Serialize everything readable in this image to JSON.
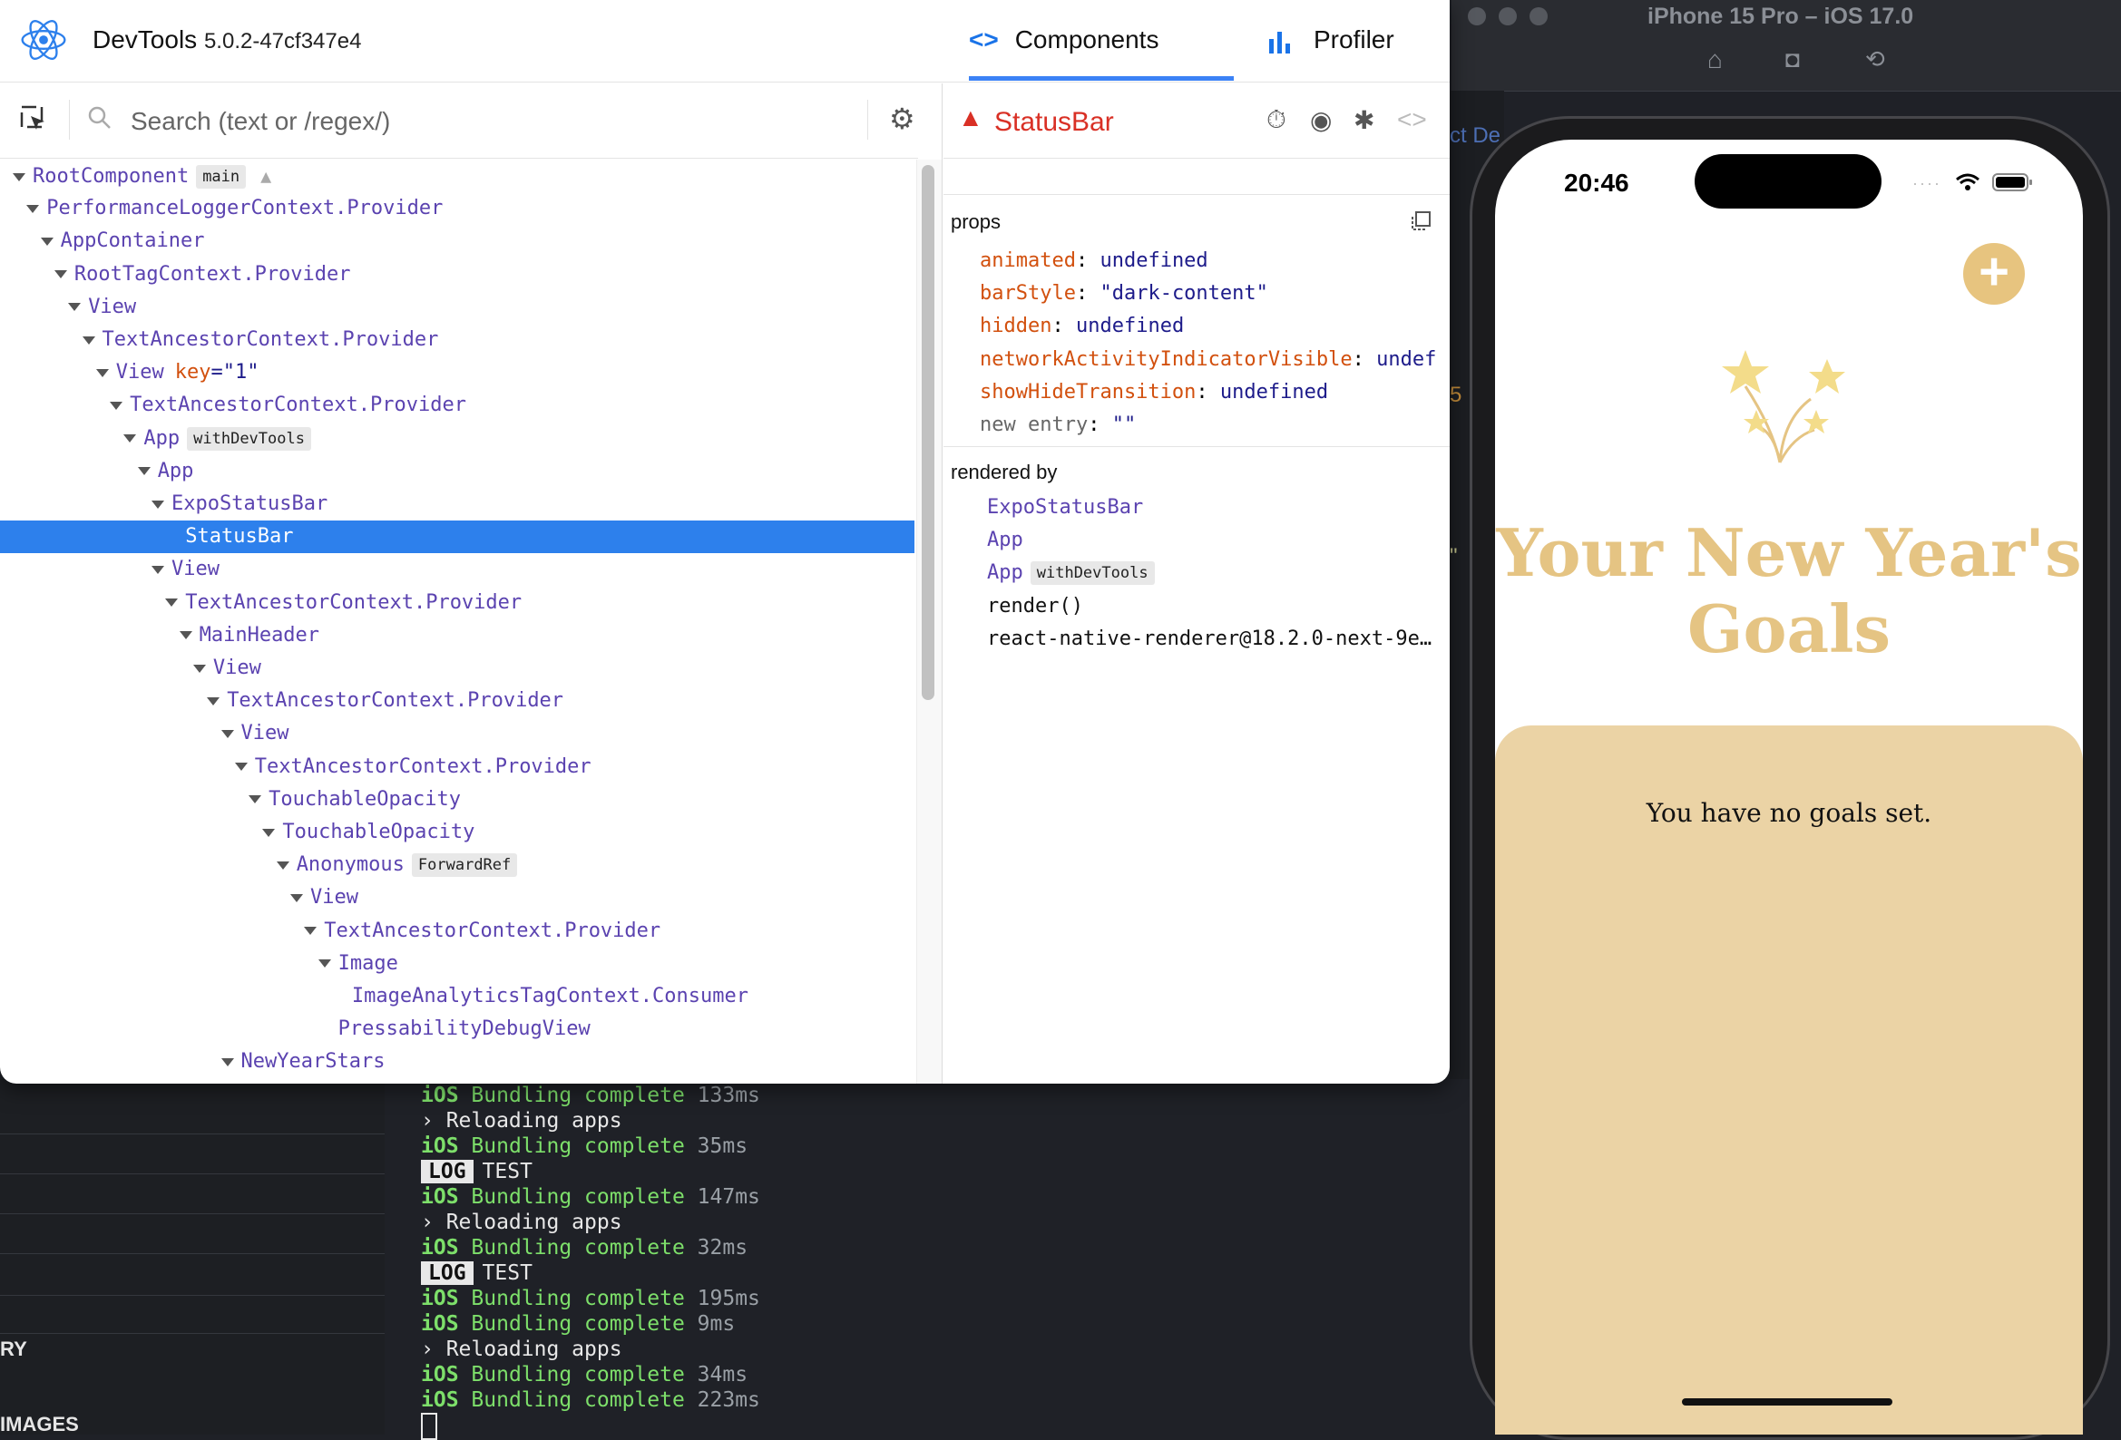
{
  "devtools": {
    "app_name": "DevTools",
    "version": "5.0.2-47cf347e4",
    "tabs": [
      {
        "label": "Components",
        "icon": "code-brackets-icon",
        "active": true
      },
      {
        "label": "Profiler",
        "icon": "bar-chart-icon",
        "active": false
      }
    ],
    "search_placeholder": "Search (text or /regex/)",
    "tree": [
      {
        "name": "RootComponent",
        "badge": "main",
        "warning": true
      },
      {
        "name": "PerformanceLoggerContext.Provider"
      },
      {
        "name": "AppContainer"
      },
      {
        "name": "RootTagContext.Provider"
      },
      {
        "name": "View"
      },
      {
        "name": "TextAncestorContext.Provider"
      },
      {
        "name": "View",
        "key_label": "key",
        "key_eq": "=",
        "key_value": "\"1\""
      },
      {
        "name": "TextAncestorContext.Provider"
      },
      {
        "name": "App",
        "badge": "withDevTools"
      },
      {
        "name": "App"
      },
      {
        "name": "ExpoStatusBar"
      },
      {
        "name": "StatusBar",
        "selected": true
      },
      {
        "name": "View"
      },
      {
        "name": "TextAncestorContext.Provider"
      },
      {
        "name": "MainHeader"
      },
      {
        "name": "View"
      },
      {
        "name": "TextAncestorContext.Provider"
      },
      {
        "name": "View"
      },
      {
        "name": "TextAncestorContext.Provider"
      },
      {
        "name": "TouchableOpacity"
      },
      {
        "name": "TouchableOpacity"
      },
      {
        "name": "Anonymous",
        "badge": "ForwardRef"
      },
      {
        "name": "View"
      },
      {
        "name": "TextAncestorContext.Provider"
      },
      {
        "name": "Image"
      },
      {
        "name": "ImageAnalyticsTagContext.Consumer"
      },
      {
        "name": "PressabilityDebugView"
      },
      {
        "name": "NewYearStars"
      }
    ],
    "selected": {
      "title": "StatusBar",
      "props_label": "props",
      "props": [
        {
          "key": "animated",
          "value": "undefined"
        },
        {
          "key": "barStyle",
          "value": "\"dark-content\""
        },
        {
          "key": "hidden",
          "value": "undefined"
        },
        {
          "key": "networkActivityIndicatorVisible",
          "value": "undef"
        },
        {
          "key": "showHideTransition",
          "value": "undefined"
        }
      ],
      "new_entry_key": "new entry",
      "new_entry_value": "\"\"",
      "rendered_by_label": "rendered by",
      "rendered_by": [
        {
          "name": "ExpoStatusBar"
        },
        {
          "name": "App"
        },
        {
          "name": "App",
          "badge": "withDevTools"
        },
        {
          "name": "render()"
        },
        {
          "name": "react-native-renderer@18.2.0-next-9e…"
        }
      ]
    }
  },
  "terminal": {
    "lines": [
      {
        "type": "bundle",
        "ms": "133ms"
      },
      {
        "type": "reload",
        "text": "› Reloading apps"
      },
      {
        "type": "bundle",
        "ms": "35ms"
      },
      {
        "type": "log",
        "tag": "LOG",
        "text": "TEST"
      },
      {
        "type": "bundle",
        "ms": "147ms"
      },
      {
        "type": "reload",
        "text": "› Reloading apps"
      },
      {
        "type": "bundle",
        "ms": "32ms"
      },
      {
        "type": "log",
        "tag": "LOG",
        "text": "TEST"
      },
      {
        "type": "bundle",
        "ms": "195ms"
      },
      {
        "type": "bundle",
        "ms": "9ms"
      },
      {
        "type": "reload",
        "text": "› Reloading apps"
      },
      {
        "type": "bundle",
        "ms": "34ms"
      },
      {
        "type": "bundle",
        "ms": "223ms"
      }
    ],
    "ios_label": "iOS",
    "bundle_label": "Bundling complete"
  },
  "left_panel": {
    "labels": [
      "RY",
      "IMAGES"
    ]
  },
  "behind_text": {
    "top": "ct De",
    "mid": "5",
    "right_top": "\""
  },
  "simulator": {
    "title": "iPhone 15 Pro – iOS 17.0",
    "status_time": "20:46",
    "add_button": "+",
    "app_title": "Your New Year's Goals",
    "empty_message": "You have no goals set.",
    "accent_color": "#e5c483",
    "panel_color": "#ebd3a5"
  }
}
